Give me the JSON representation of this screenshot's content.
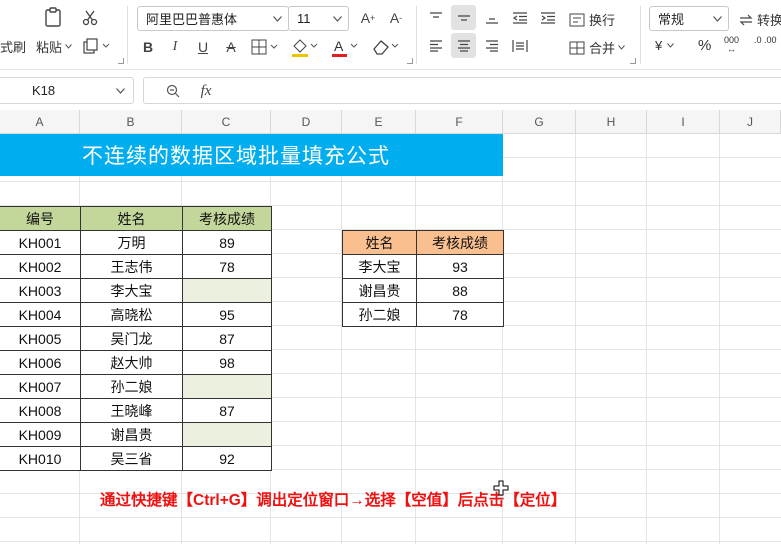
{
  "ribbon": {
    "format_painter": "式刷",
    "paste": "粘贴",
    "font_name": "阿里巴巴普惠体",
    "font_size": "11",
    "bold": "B",
    "italic": "I",
    "underline": "U",
    "wrap_text": "换行",
    "merge": "合并",
    "number_format": "常规",
    "convert": "转换",
    "currency_symbol": "¥",
    "percent_symbol": "%",
    "thousands_symbol": "000"
  },
  "formula_bar": {
    "name_box": "K18",
    "fx": "fx",
    "formula": ""
  },
  "columns": [
    "A",
    "B",
    "C",
    "D",
    "E",
    "F",
    "G",
    "H",
    "I",
    "J"
  ],
  "sheet": {
    "title": "不连续的数据区域批量填充公式",
    "left_table": {
      "headers": [
        "编号",
        "姓名",
        "考核成绩"
      ],
      "rows": [
        [
          "KH001",
          "万明",
          "89"
        ],
        [
          "KH002",
          "王志伟",
          "78"
        ],
        [
          "KH003",
          "李大宝",
          ""
        ],
        [
          "KH004",
          "高晓松",
          "95"
        ],
        [
          "KH005",
          "吴门龙",
          "87"
        ],
        [
          "KH006",
          "赵大帅",
          "98"
        ],
        [
          "KH007",
          "孙二娘",
          ""
        ],
        [
          "KH008",
          "王晓峰",
          "87"
        ],
        [
          "KH009",
          "谢昌贵",
          ""
        ],
        [
          "KH010",
          "吴三省",
          "92"
        ]
      ]
    },
    "right_table": {
      "headers": [
        "姓名",
        "考核成绩"
      ],
      "rows": [
        [
          "李大宝",
          "93"
        ],
        [
          "谢昌贵",
          "88"
        ],
        [
          "孙二娘",
          "78"
        ]
      ]
    },
    "instruction": "通过快捷键【Ctrl+G】调出定位窗口→选择【空值】后点击【定位】"
  },
  "colors": {
    "banner": "#00aeef",
    "header_green": "#c4d79b",
    "empty_cell": "#ebf1de",
    "header_orange": "#fabf8f",
    "instruction": "#ee1111"
  }
}
